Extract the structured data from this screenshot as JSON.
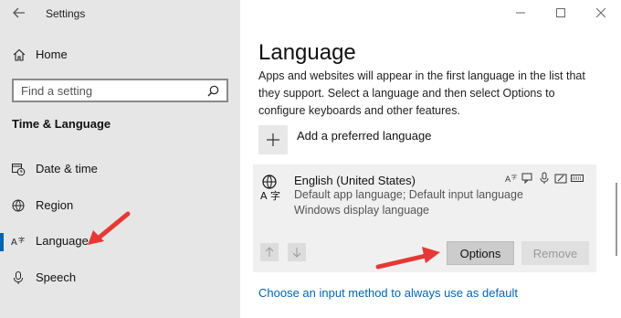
{
  "window": {
    "title": "Settings"
  },
  "sidebar": {
    "home_label": "Home",
    "search_placeholder": "Find a setting",
    "section_title": "Time & Language",
    "items": [
      {
        "label": "Date & time",
        "icon": "calendar-clock-icon"
      },
      {
        "label": "Region",
        "icon": "globe-pin-icon"
      },
      {
        "label": "Language",
        "icon": "language-icon",
        "active": true
      },
      {
        "label": "Speech",
        "icon": "microphone-icon"
      }
    ]
  },
  "main": {
    "title": "Language",
    "description": "Apps and websites will appear in the first language in the list that they support. Select a language and then select Options to configure keyboards and other features.",
    "add_language_label": "Add a preferred language",
    "language": {
      "name": "English (United States)",
      "line1": "Default app language; Default input language",
      "line2": "Windows display language",
      "options_label": "Options",
      "remove_label": "Remove"
    },
    "link_text": "Choose an input method to always use as default"
  },
  "colors": {
    "accent": "#0063b1",
    "link": "#0066b4",
    "annotation": "#e53935"
  }
}
